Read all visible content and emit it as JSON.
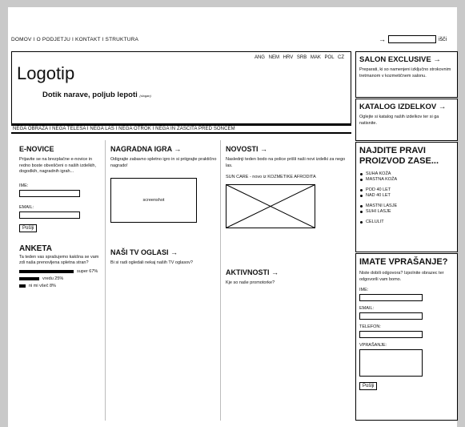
{
  "topnav": {
    "text": "DOMOV  I  O PODJETJU  I  KONTAKT  I  STRUKTURA"
  },
  "search": {
    "arrow": "→",
    "button": "išči"
  },
  "header": {
    "logo": "Logotip",
    "tagline": "Dotik narave, poljub lepoti",
    "tagline_small": "(slogan)",
    "languages": "ANG  NEM  HRV  SRB  MAK  POL  CZ"
  },
  "categories": {
    "text": "NEGA OBRAZA   I   NEGA TELESA   I   NEGA LAS   I   NEGA OTROK   I   NEGA IN ZAŠČITA PRED SONCEM"
  },
  "sidebar": {
    "salon": {
      "title": "SALON EXCLUSIVE",
      "text": "Preparati, ki so namenjeni izključno strokovnim tretmanom v kozmetičnem salonu."
    },
    "katalog": {
      "title": "KATALOG IZDELKOV",
      "text": "Oglejte si katalog naših izdelkov ter si ga natisnite."
    },
    "product": {
      "title": "NAJDITE PRAVI PROIZVOD ZASE...",
      "groups": [
        [
          "SUHA KOŽA",
          "MASTNA KOŽA"
        ],
        [
          "POD 40 LET",
          "NAD 40 LET"
        ],
        [
          "MASTNI LASJE",
          "SUHI LASJE"
        ],
        [
          "CELULIT"
        ]
      ]
    },
    "question": {
      "title": "IMATE VPRAŠANJE?",
      "text": "Niste dobili odgovora? Izpolnite obrazec ter odgovorili vam bomo.",
      "labels": {
        "ime": "IME:",
        "email": "EMAIL:",
        "telefon": "TELEFON:",
        "vprasanje": "VPRAŠANJE:"
      },
      "send": "Pošlji"
    }
  },
  "enovice": {
    "title": "E-NOVICE",
    "text": "Prijavite se na brezplačne e-novice in redno boste obveščeni o naših izdelkih, dogodkih, nagradnih igrah...",
    "ime_label": "IME:",
    "email_label": "EMAIL:",
    "send": "Pošlji"
  },
  "anketa": {
    "title": "ANKETA",
    "text": "Ta teden vas sprašujemo kakšna se vam zdi naša prenovljena spletna stran?",
    "options": [
      {
        "label": "super 67%",
        "value": 0.67
      },
      {
        "label": "vredu  25%",
        "value": 0.25
      },
      {
        "label": "ni mi všeč  8%",
        "value": 0.08
      }
    ]
  },
  "nagradna": {
    "title": "NAGRADNA IGRA",
    "text": "Odigrajte zabavno spletno igro in si priigrajte praktično nagrado!",
    "screenshot": "screenshot"
  },
  "tv": {
    "title": "NAŠI TV OGLASI",
    "text": "Bi si radi ogledali nekaj naših TV oglasov?"
  },
  "novosti": {
    "title": "NOVOSTI",
    "text": "Naslednji teden bodo na police prišli naši novi izdelki za nego las.",
    "subtitle": "SUN CARE - novo iz KOZMETIKE AFRODITA"
  },
  "aktivnosti": {
    "title": "AKTIVNOSTI",
    "text": "Kje so naše promotorke?"
  }
}
